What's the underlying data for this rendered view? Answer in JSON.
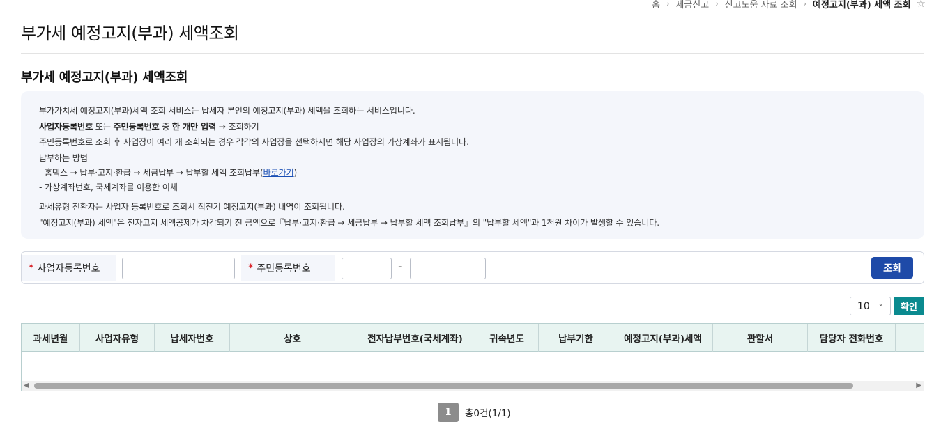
{
  "breadcrumb": {
    "items": [
      "홈",
      "세금신고",
      "신고도움 자료 조회"
    ],
    "current": "예정고지(부과) 세액 조회",
    "favorite_icon": "star-icon"
  },
  "page_title": "부가세 예정고지(부과) 세액조회",
  "section_title": "부가세 예정고지(부과) 세액조회",
  "info": {
    "line1": "부가가치세 예정고지(부과)세액 조회 서비스는 납세자 본인의 예정고지(부과) 세액을 조회하는 서비스입니다.",
    "line2_bold1": "사업자등록번호",
    "line2_text1": " 또는 ",
    "line2_bold2": "주민등록번호",
    "line2_text2": " 중 ",
    "line2_bold3": "한 개만 입력",
    "line2_text3": " → 조회하기",
    "line3": "주민등록번호로 조회 후 사업장이 여러 개 조회되는 경우 각각의 사업장을 선택하시면 해당 사업장의 가상계좌가 표시됩니다.",
    "line4": "납부하는 방법",
    "sub1_text": "- 홈택스 → 납부·고지·환급 → 세금납부 → 납부할 세액 조회납부(",
    "sub1_link": "바로가기",
    "sub1_end": ")",
    "sub2": "- 가상계좌번호, 국세계좌를 이용한 이체",
    "line5": "과세유형 전환자는 사업자 등록번호로 조회시 직전기 예정고지(부과) 내역이 조회됩니다.",
    "line6": "\"예정고지(부과) 세액\"은 전자고지 세액공제가 차감되기 전 금액으로『납부·고지·환급 → 세금납부 → 납부할 세액 조회납부』의 \"납부할 세액\"과 1천원 차이가 발생할 수 있습니다."
  },
  "search": {
    "required_mark": "*",
    "biz_label": "사업자등록번호",
    "biz_value": "",
    "resident_label": "주민등록번호",
    "resident_front_value": "",
    "resident_back_value": "",
    "dash": "-",
    "search_button": "조회"
  },
  "list_controls": {
    "page_size": "10",
    "confirm_button": "확인"
  },
  "grid": {
    "columns": [
      "과세년월",
      "사업자유형",
      "납세자번호",
      "상호",
      "전자납부번호(국세계좌)",
      "귀속년도",
      "납부기한",
      "예정고지(부과)세액",
      "관할서",
      "담당자 전화번호"
    ],
    "rows": []
  },
  "pagination": {
    "current_page": "1",
    "total_text": "총0건(1/1)"
  }
}
